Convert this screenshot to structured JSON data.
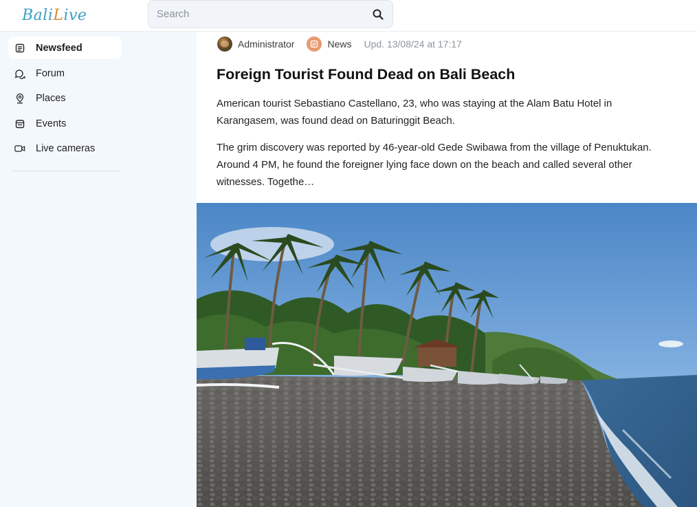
{
  "header": {
    "logo": {
      "part1": "Bali",
      "part2": "L",
      "part3": "ive"
    },
    "search": {
      "placeholder": "Search",
      "value": ""
    }
  },
  "sidebar": {
    "items": [
      {
        "label": "Newsfeed",
        "icon": "newsfeed-icon",
        "active": true
      },
      {
        "label": "Forum",
        "icon": "forum-icon",
        "active": false
      },
      {
        "label": "Places",
        "icon": "location-pin-icon",
        "active": false
      },
      {
        "label": "Events",
        "icon": "calendar-icon",
        "active": false
      },
      {
        "label": "Live cameras",
        "icon": "video-camera-icon",
        "active": false
      }
    ]
  },
  "article": {
    "author": "Administrator",
    "category": "News",
    "updated": "Upd. 13/08/24 at 17:17",
    "title": "Foreign Tourist Found Dead on Bali Beach",
    "paragraph1": "American tourist Sebastiano Castellano, 23, who was staying at the Alam Batu Hotel in Karangasem, was found dead on Baturinggit Beach.",
    "paragraph2": "The grim discovery was reported by 46-year-old Gede Swibawa from the village of Penuktukan. Around 4 PM, he found the foreigner lying face down on the beach and called several other witnesses. Togethe…"
  },
  "colors": {
    "sidebar_bg": "#f3f8fd",
    "logo_blue": "#3b9fc4",
    "logo_orange": "#e0892b",
    "category_icon": "#e79a72"
  }
}
